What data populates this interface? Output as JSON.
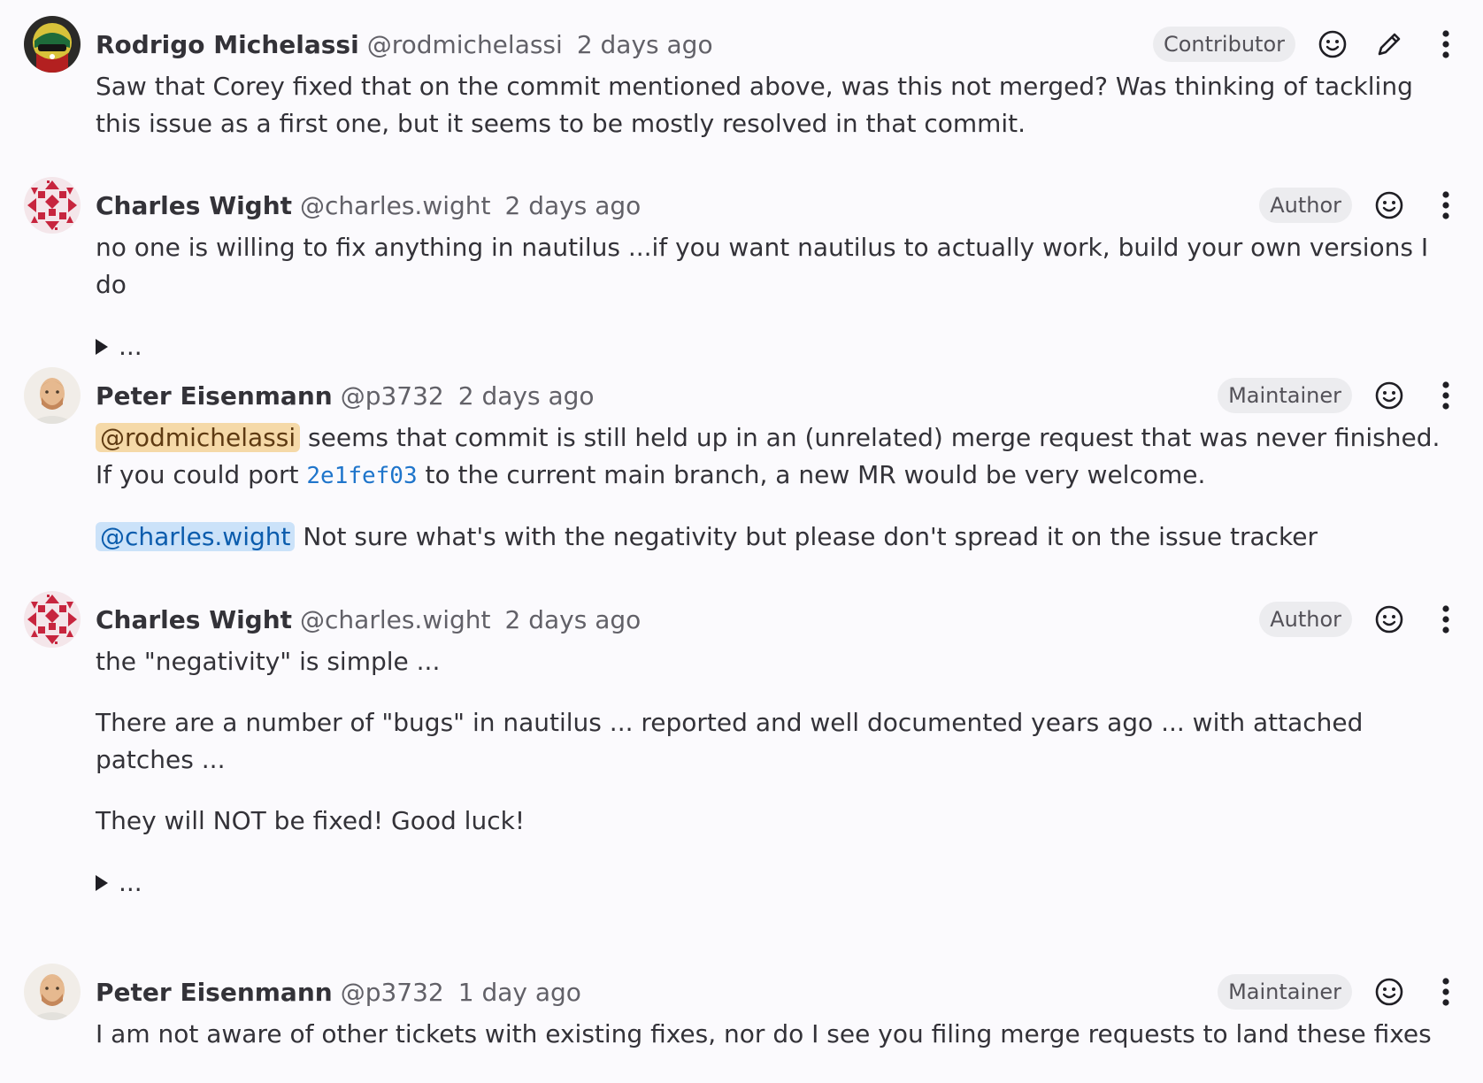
{
  "notes": [
    {
      "author": "Rodrigo Michelassi",
      "username": "@rodmichelassi",
      "time": "2 days ago",
      "role": "Contributor",
      "icons": [
        "smiley-icon",
        "pencil-icon",
        "kebab-menu-icon"
      ],
      "body": {
        "text": "Saw that Corey fixed that on the commit mentioned above, was this not merged? Was thinking of tackling this issue as a first one, but it seems to be mostly resolved in that commit."
      }
    },
    {
      "author": "Charles Wight",
      "username": "@charles.wight",
      "time": "2 days ago",
      "role": "Author",
      "icons": [
        "smiley-icon",
        "kebab-menu-icon"
      ],
      "body": {
        "text": "no one is willing to fix anything in nautilus ...if you want nautilus to actually work, build your own versions I do",
        "details_label": "..."
      }
    },
    {
      "author": "Peter Eisenmann",
      "username": "@p3732",
      "time": "2 days ago",
      "role": "Maintainer",
      "icons": [
        "smiley-icon",
        "kebab-menu-icon"
      ],
      "body": {
        "p1_mention": "@rodmichelassi",
        "p1_text_a": " seems that commit is still held up in an (unrelated) merge request that was never finished. If you could port ",
        "p1_commit": "2e1fef03",
        "p1_text_b": " to the current main branch, a new MR would be very welcome.",
        "p2_mention": "@charles.wight",
        "p2_text": " Not sure what's with the negativity but please don't spread it on the issue tracker"
      }
    },
    {
      "author": "Charles Wight",
      "username": "@charles.wight",
      "time": "2 days ago",
      "role": "Author",
      "icons": [
        "smiley-icon",
        "kebab-menu-icon"
      ],
      "body": {
        "p1": "the \"negativity\" is simple ...",
        "p2": "There are a number of \"bugs\" in nautilus ... reported and well documented years ago ... with attached patches ...",
        "p3": "They will NOT be fixed! Good luck!",
        "details_label": "..."
      }
    },
    {
      "author": "Peter Eisenmann",
      "username": "@p3732",
      "time": "1 day ago",
      "role": "Maintainer",
      "icons": [
        "smiley-icon",
        "kebab-menu-icon"
      ],
      "body": {
        "text": "I am not aware of other tickets with existing fixes, nor do I see you filing merge requests to land these fixes"
      }
    }
  ],
  "colors": {
    "background": "#fbfafd",
    "text": "#333238",
    "muted": "#626168",
    "badge_bg": "#ececef",
    "mention_self_bg": "#f5d9a8",
    "mention_other_bg": "#cbe2f9",
    "link": "#1f75cb"
  }
}
